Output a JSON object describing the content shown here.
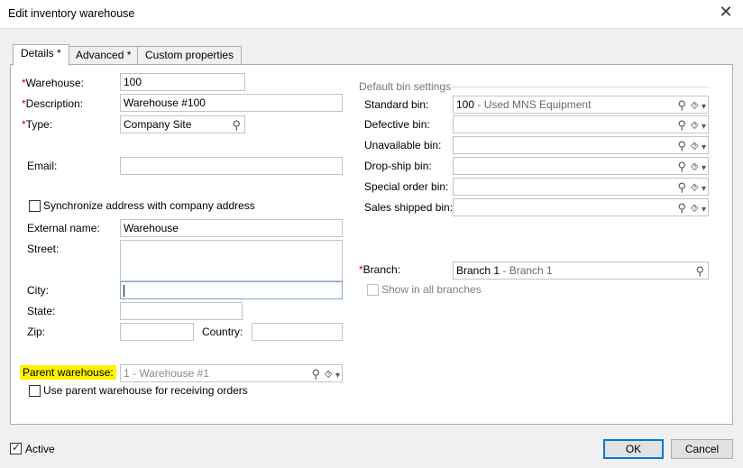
{
  "window": {
    "title": "Edit inventory warehouse",
    "close_icon": "close-icon"
  },
  "tabs": [
    "Details *",
    "Advanced *",
    "Custom properties"
  ],
  "required_mark": "*",
  "left": {
    "warehouse": {
      "label": "Warehouse:",
      "value": "100"
    },
    "description": {
      "label": "Description:",
      "value": "Warehouse #100"
    },
    "type": {
      "label": "Type:",
      "value": "Company Site"
    },
    "email": {
      "label": "Email:",
      "value": ""
    },
    "sync_checkbox": {
      "label": "Synchronize address with company address",
      "checked": false
    },
    "external_name": {
      "label": "External name:",
      "value": "Warehouse"
    },
    "street": {
      "label": "Street:",
      "value": ""
    },
    "city": {
      "label": "City:",
      "value": ""
    },
    "state": {
      "label": "State:",
      "value": ""
    },
    "zip": {
      "label": "Zip:",
      "value": ""
    },
    "country": {
      "label": "Country:",
      "value": ""
    },
    "parent_warehouse": {
      "label": "Parent warehouse:",
      "code": "1",
      "name": "Warehouse #1",
      "highlight_color": "#fff200"
    },
    "use_parent_checkbox": {
      "label": "Use parent warehouse for receiving orders",
      "checked": false
    }
  },
  "right": {
    "group_title": "Default bin settings",
    "standard_bin": {
      "label": "Standard bin:",
      "code": "100",
      "name": "Used MNS Equipment"
    },
    "defective_bin": {
      "label": "Defective bin:"
    },
    "unavailable_bin": {
      "label": "Unavailable bin:"
    },
    "dropship_bin": {
      "label": "Drop-ship bin:"
    },
    "special_order_bin": {
      "label": "Special order bin:"
    },
    "sales_shipped_bin": {
      "label": "Sales shipped bin:"
    },
    "branch": {
      "label": "Branch:",
      "code": "Branch 1",
      "name": "Branch 1"
    },
    "show_all_branches": {
      "label": "Show in all branches",
      "checked": false,
      "disabled": true
    }
  },
  "footer": {
    "active": {
      "label": "Active",
      "checked": true
    },
    "ok_label": "OK",
    "cancel_label": "Cancel"
  },
  "glyphs": {
    "search": "⚲",
    "bookmark": "⯑",
    "dropdown": "▾",
    "separator": " - "
  }
}
